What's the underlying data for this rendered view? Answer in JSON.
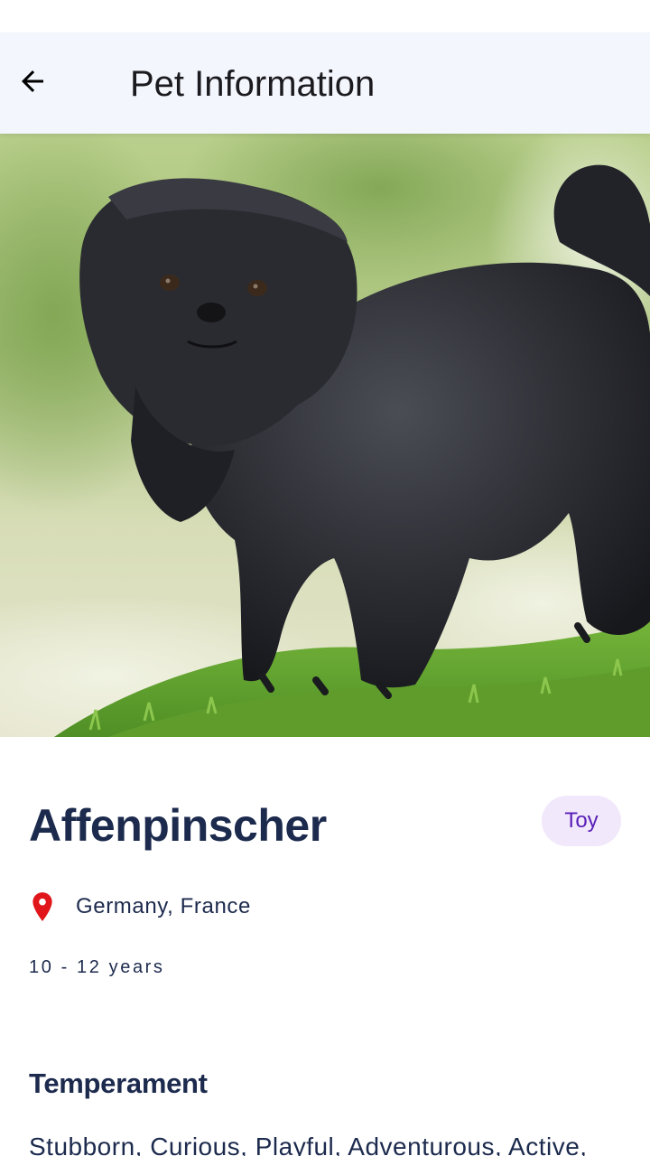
{
  "app_bar": {
    "title": "Pet Information",
    "back_icon": "arrow-left-icon"
  },
  "hero": {
    "image": "affenpinscher-dog-photo"
  },
  "breed": {
    "name": "Affenpinscher",
    "group": "Toy",
    "origin_icon": "location-pin-icon",
    "origin_color": "#e0161b",
    "origin": "Germany, France",
    "life_span": "10 - 12 years"
  },
  "temperament": {
    "heading": "Temperament",
    "text": "Stubborn, Curious, Playful, Adventurous, Active,"
  },
  "colors": {
    "app_bar_bg": "#f3f6fd",
    "text_primary": "#1c2a4d",
    "chip_bg": "#f1e8fb",
    "chip_text": "#5a1fb8"
  }
}
